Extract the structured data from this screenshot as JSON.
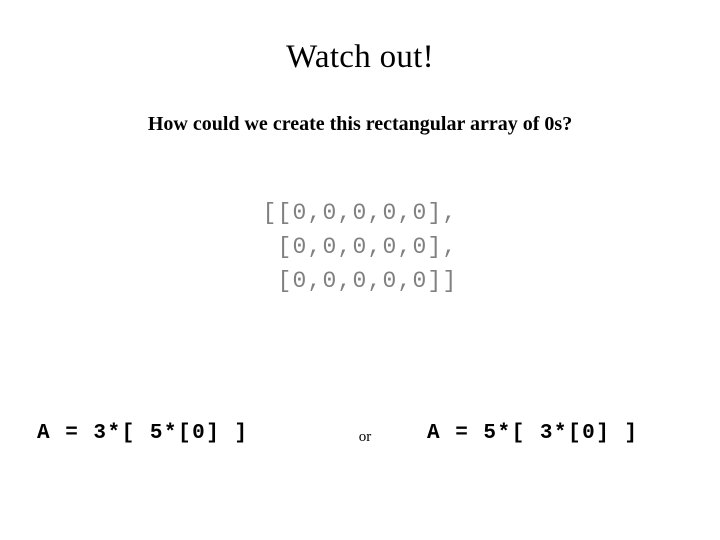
{
  "slide": {
    "title": "Watch out!",
    "subtitle": "How could we create this rectangular array of 0s?",
    "array_example": {
      "lines": [
        "[[0,0,0,0,0],",
        " [0,0,0,0,0],",
        " [0,0,0,0,0]]"
      ],
      "text_color": "#808080"
    },
    "answers": {
      "left_code": "A = 3*[ 5*[0] ]",
      "separator": "or",
      "right_code": "A = 5*[ 3*[0] ]",
      "text_color": "#000000"
    },
    "background_color": "#ffffff"
  }
}
